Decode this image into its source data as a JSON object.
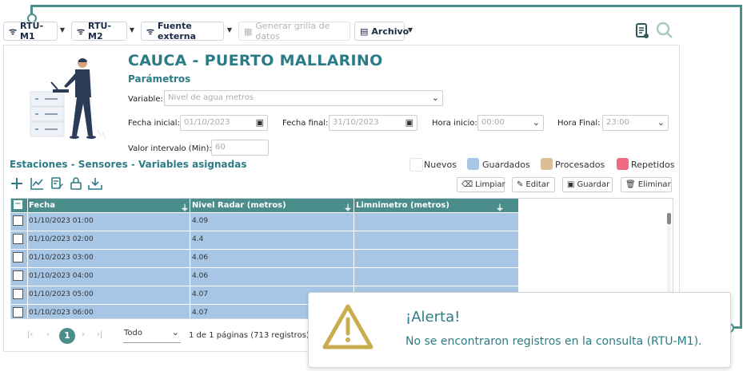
{
  "toolbar": {
    "rtu_m1": "RTU-M1",
    "rtu_m2": "RTU-M2",
    "fuente_externa": "Fuente externa",
    "generar_grilla": "Generar grilla de datos",
    "archivo": "Archivo"
  },
  "header": {
    "title": "CAUCA - PUERTO MALLARINO",
    "subtitle": "Parámetros"
  },
  "form": {
    "variable_label": "Variable:",
    "variable_value": "Nivel de agua metros",
    "fecha_inicial_label": "Fecha inicial:",
    "fecha_inicial_value": "01/10/2023",
    "fecha_final_label": "Fecha final:",
    "fecha_final_value": "31/10/2023",
    "hora_inicio_label": "Hora inicio:",
    "hora_inicio_value": "00:00",
    "hora_final_label": "Hora Final:",
    "hora_final_value": "23:00",
    "intervalo_label": "Valor intervalo (Min):",
    "intervalo_value": "60"
  },
  "section": {
    "title": "Estaciones - Sensores - Variables asignadas"
  },
  "legend": [
    {
      "label": "Nuevos",
      "color": "#ffffff"
    },
    {
      "label": "Guardados",
      "color": "#a7c6e6"
    },
    {
      "label": "Procesados",
      "color": "#d9bf97"
    },
    {
      "label": "Repetidos",
      "color": "#f06b81"
    }
  ],
  "actions": {
    "limpiar": "Limpiar",
    "editar": "Editar",
    "guardar": "Guardar",
    "eliminar": "Eliminar"
  },
  "grid": {
    "columns": [
      "Fecha",
      "Nivel Radar (metros)",
      "Limnimetro (metros)"
    ],
    "rows": [
      {
        "fecha": "01/10/2023 01:00",
        "radar": "4.09",
        "limni": ""
      },
      {
        "fecha": "01/10/2023 02:00",
        "radar": "4.4",
        "limni": ""
      },
      {
        "fecha": "01/10/2023 03:00",
        "radar": "4.06",
        "limni": ""
      },
      {
        "fecha": "01/10/2023 04:00",
        "radar": "4.06",
        "limni": ""
      },
      {
        "fecha": "01/10/2023 05:00",
        "radar": "4.07",
        "limni": ""
      },
      {
        "fecha": "01/10/2023 06:00",
        "radar": "4.07",
        "limni": ""
      }
    ]
  },
  "pager": {
    "current_page": "1",
    "page_size": "Todo",
    "summary": "1 de 1 páginas (713 registros)"
  },
  "alert": {
    "title": "¡Alerta!",
    "message": "No se encontraron registros en la consulta (RTU-M1)."
  }
}
